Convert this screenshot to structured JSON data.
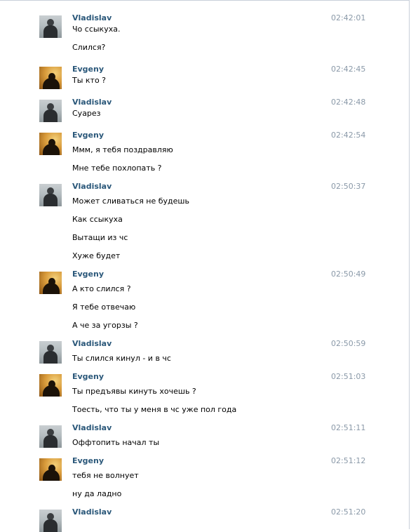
{
  "messages": [
    {
      "author": "Vladislav",
      "avatar": "vladislav-avatar",
      "time": "02:42:01",
      "lines": [
        "Чо ссыкуха.",
        "Слился?"
      ]
    },
    {
      "author": "Evgeny",
      "avatar": "evgeny-avatar",
      "time": "02:42:45",
      "lines": [
        "Ты кто ?"
      ]
    },
    {
      "author": "Vladislav",
      "avatar": "vladislav-avatar",
      "time": "02:42:48",
      "lines": [
        "Суарез"
      ]
    },
    {
      "author": "Evgeny",
      "avatar": "evgeny-avatar",
      "time": "02:42:54",
      "lines": [
        "Ммм, я тебя поздравляю",
        "Мне тебе похлопать ?"
      ]
    },
    {
      "author": "Vladislav",
      "avatar": "vladislav-avatar",
      "time": "02:50:37",
      "lines": [
        "Может сливаться не будешь",
        "Как ссыкуха",
        "Вытащи из чс",
        "Хуже будет"
      ]
    },
    {
      "author": "Evgeny",
      "avatar": "evgeny-avatar",
      "time": "02:50:49",
      "lines": [
        "А кто слился ?",
        "Я тебе отвечаю",
        "А че за угорзы ?"
      ]
    },
    {
      "author": "Vladislav",
      "avatar": "vladislav-avatar",
      "time": "02:50:59",
      "lines": [
        "Ты слился кинул - и в чс"
      ]
    },
    {
      "author": "Evgeny",
      "avatar": "evgeny-avatar",
      "time": "02:51:03",
      "lines": [
        "Ты предъявы кинуть хочешь ?",
        "Тоесть, что ты у меня в чс уже пол года"
      ]
    },
    {
      "author": "Vladislav",
      "avatar": "vladislav-avatar",
      "time": "02:51:11",
      "lines": [
        "Оффтопить начал ты"
      ]
    },
    {
      "author": "Evgeny",
      "avatar": "evgeny-avatar",
      "time": "02:51:12",
      "lines": [
        "тебя не волнует",
        "ну да ладно"
      ]
    },
    {
      "author": "Vladislav",
      "avatar": "vladislav-avatar",
      "time": "02:51:20",
      "lines": []
    }
  ],
  "colors": {
    "author": "#2b587a",
    "time": "#8a99a8",
    "text": "#000000",
    "border": "#c8cfd9"
  }
}
